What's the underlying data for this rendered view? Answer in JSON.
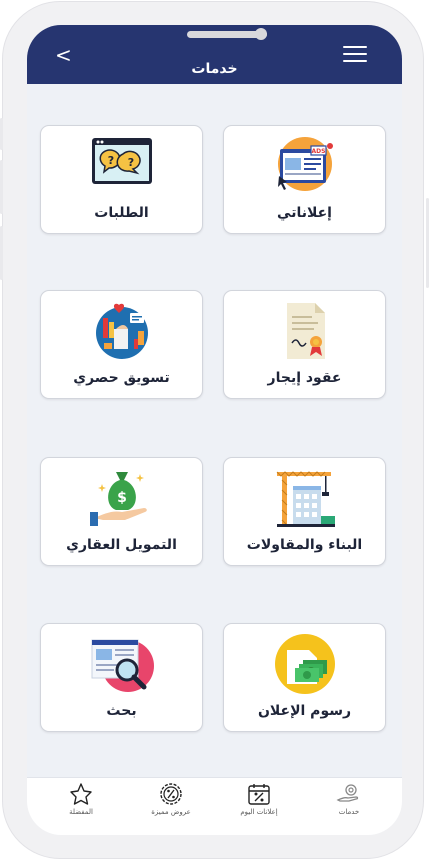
{
  "header": {
    "title": "خدمات",
    "back_glyph": "<"
  },
  "services": [
    {
      "label": "إعلاناتي",
      "icon": "ads-billboard-icon"
    },
    {
      "label": "الطلبات",
      "icon": "chat-bubbles-icon"
    },
    {
      "label": "عقود إيجار",
      "icon": "contract-certificate-icon"
    },
    {
      "label": "تسويق حصري",
      "icon": "marketing-icon"
    },
    {
      "label": "البناء والمقاولات",
      "icon": "construction-crane-icon"
    },
    {
      "label": "التمويل العقاري",
      "icon": "money-bag-hand-icon"
    },
    {
      "label": "رسوم الإعلان",
      "icon": "banknotes-icon"
    },
    {
      "label": "بحث",
      "icon": "search-magnifier-icon"
    }
  ],
  "tabbar": [
    {
      "label": "خدمات",
      "icon": "services-hand-icon"
    },
    {
      "label": "إعلانات اليوم",
      "icon": "calendar-percent-icon"
    },
    {
      "label": "عروض مميزة",
      "icon": "percent-badge-icon"
    },
    {
      "label": "المفضلة",
      "icon": "star-icon"
    }
  ],
  "colors": {
    "header": "#263570",
    "background": "#eef1f6",
    "card": "#ffffff"
  }
}
